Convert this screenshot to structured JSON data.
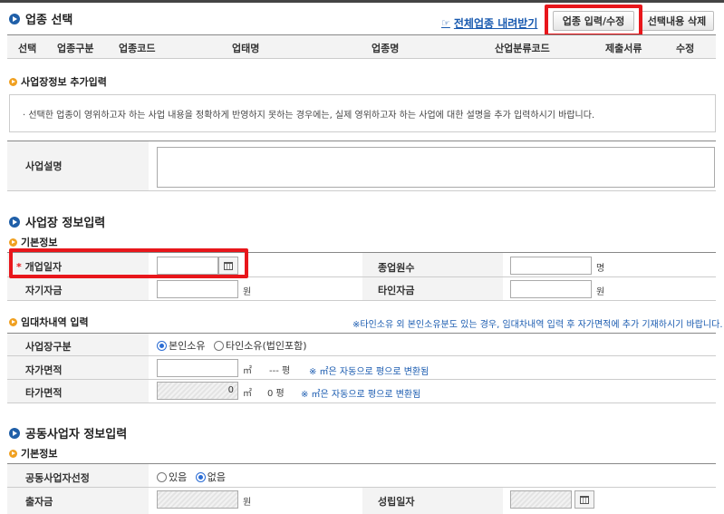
{
  "section1": {
    "title": "업종 선택",
    "download_link": "전체업종 내려받기",
    "btn_input": "업종 입력/수정",
    "btn_delete": "선택내용 삭제",
    "columns": [
      "선택",
      "업종구분",
      "업종코드",
      "업태명",
      "업종명",
      "산업분류코드",
      "제출서류",
      "수정"
    ]
  },
  "extra": {
    "title": "사업장정보 추가입력",
    "notice": "선택한 업종이 영위하고자 하는 사업 내용을 정확하게 반영하지 못하는 경우에는, 실제 영위하고자 하는 사업에 대한 설명을 추가 입력하시기 바랍니다.",
    "desc_label": "사업설명"
  },
  "workplace": {
    "title": "사업장 정보입력",
    "basic": "기본정보",
    "open_date_label": "개업일자",
    "required_mark": "*",
    "employees_label": "종업원수",
    "employees_unit": "명",
    "own_capital_label": "자기자금",
    "own_capital_unit": "원",
    "other_capital_label": "타인자금",
    "other_capital_unit": "원"
  },
  "lease": {
    "title": "임대차내역 입력",
    "notice": "※타인소유 외 본인소유분도 있는 경우, 임대차내역 입력 후 자가면적에 추가 기재하시기 바랍니다.",
    "type_label": "사업장구분",
    "opt_own": "본인소유",
    "opt_other": "타인소유(법인포함)",
    "own_area_label": "자가면적",
    "own_area_unit": "㎡",
    "own_area_pyeong": "--- 평",
    "own_area_note": "※ ㎡은 자동으로 평으로 변환됨",
    "other_area_label": "타가면적",
    "other_area_value": "0",
    "other_area_unit": "㎡",
    "other_area_pyeong": "0 평",
    "other_area_note": "※ ㎡은 자동으로 평으로 변환됨"
  },
  "joint": {
    "title": "공동사업자 정보입력",
    "basic": "기본정보",
    "select_label": "공동사업자선정",
    "opt_yes": "있음",
    "opt_no": "없음",
    "capital_label": "출자금",
    "capital_unit": "원",
    "est_date_label": "성립일자"
  },
  "colors": {
    "highlight": "#e8161b",
    "link": "#1a5bb0",
    "label_bg": "#f3f3f3"
  }
}
